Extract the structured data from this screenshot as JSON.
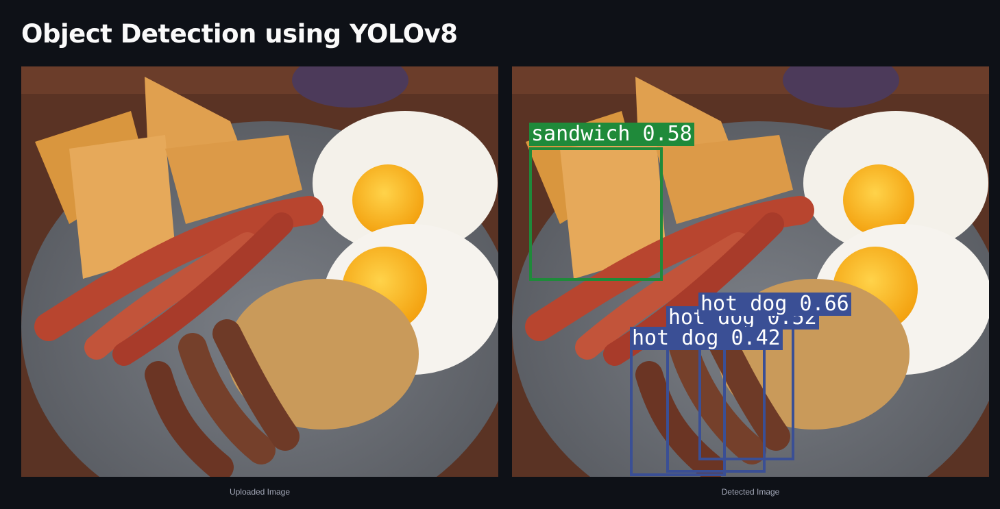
{
  "page": {
    "title": "Object Detection using YOLOv8"
  },
  "images": [
    {
      "caption": "Uploaded Image"
    },
    {
      "caption": "Detected Image"
    }
  ],
  "detections": [
    {
      "class": "sandwich",
      "confidence": "0.58",
      "text": "sandwich 0.58",
      "color": "#1f8a3a"
    },
    {
      "class": "hot dog",
      "confidence": "0.66",
      "text": "hot dog 0.66",
      "color": "#3a4f95"
    },
    {
      "class": "hot dog",
      "confidence": "0.52",
      "text": "hot dog 0.52",
      "color": "#3a4f95"
    },
    {
      "class": "hot dog",
      "confidence": "0.42",
      "text": "hot dog 0.42",
      "color": "#3a4f95"
    }
  ]
}
